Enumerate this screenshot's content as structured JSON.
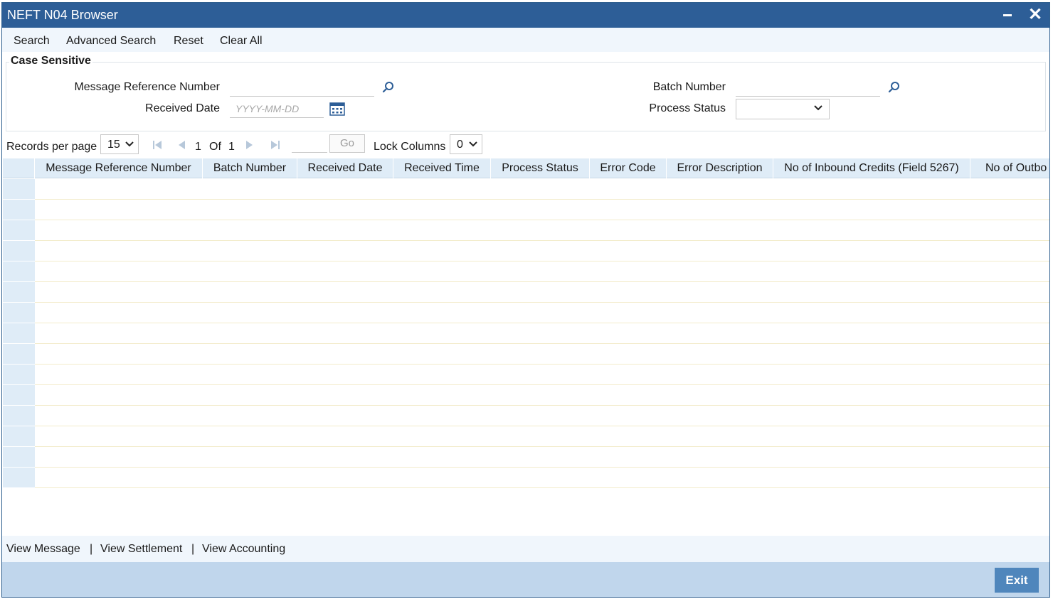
{
  "window": {
    "title": "NEFT N04 Browser"
  },
  "menu": {
    "search": "Search",
    "advanced_search": "Advanced Search",
    "reset": "Reset",
    "clear_all": "Clear All"
  },
  "search_panel": {
    "legend": "Case Sensitive",
    "message_reference_label": "Message Reference Number",
    "message_reference_value": "",
    "batch_number_label": "Batch Number",
    "batch_number_value": "",
    "received_date_label": "Received Date",
    "received_date_placeholder": "YYYY-MM-DD",
    "process_status_label": "Process Status",
    "process_status_value": ""
  },
  "pager": {
    "records_label": "Records per page",
    "records_value": "15",
    "current_page": "1",
    "of_label": "Of",
    "total_pages": "1",
    "go_label": "Go",
    "lock_label": "Lock Columns",
    "lock_value": "0"
  },
  "grid": {
    "columns": [
      "Message Reference Number",
      "Batch Number",
      "Received Date",
      "Received Time",
      "Process Status",
      "Error Code",
      "Error Description",
      "No of Inbound Credits (Field 5267)",
      "No of Outbo"
    ],
    "row_count": 15
  },
  "bottom_links": {
    "view_message": "View Message",
    "view_settlement": "View Settlement",
    "view_accounting": "View Accounting",
    "separator": "|"
  },
  "footer": {
    "exit_label": "Exit"
  },
  "colors": {
    "title_bar": "#2d5e97",
    "header_bg": "#dfecf7",
    "footer_bg": "#c0d6ec",
    "exit_button": "#4f86bc"
  }
}
